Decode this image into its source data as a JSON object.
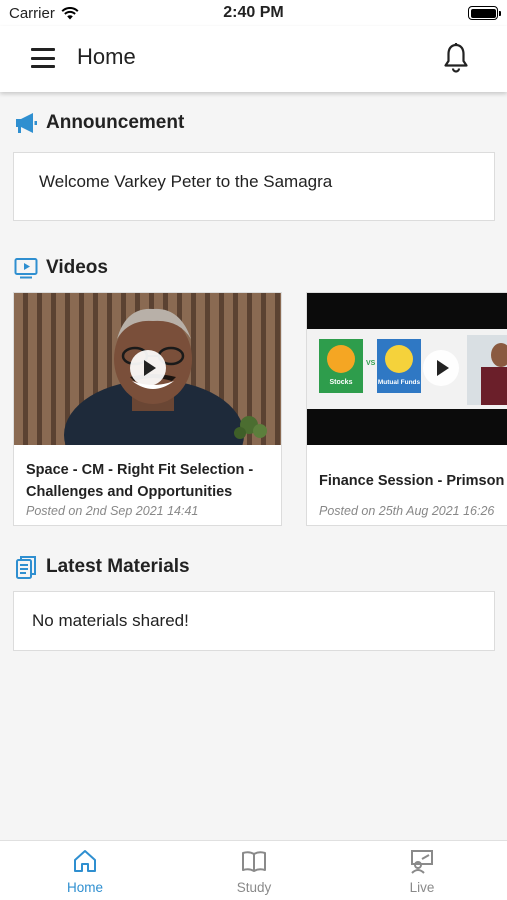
{
  "status_bar": {
    "carrier": "Carrier",
    "time": "2:40 PM"
  },
  "header": {
    "title": "Home"
  },
  "announcement": {
    "heading": "Announcement",
    "text": "Welcome Varkey Peter to the Samagra"
  },
  "videos": {
    "heading": "Videos",
    "items": [
      {
        "title": "Space - CM - Right Fit Selection - Challenges and Opportunities",
        "posted": "Posted on 2nd Sep 2021 14:41"
      },
      {
        "title": "Finance Session - Primson",
        "posted": "Posted on 25th Aug 2021 16:26",
        "thumb_left_label": "Stocks",
        "thumb_vs": "VS",
        "thumb_right_label": "Mutual Funds"
      }
    ]
  },
  "materials": {
    "heading": "Latest Materials",
    "empty_text": "No materials shared!"
  },
  "tabs": [
    {
      "label": "Home",
      "icon": "home-icon",
      "active": true
    },
    {
      "label": "Study",
      "icon": "book-icon",
      "active": false
    },
    {
      "label": "Live",
      "icon": "live-class-icon",
      "active": false
    }
  ],
  "colors": {
    "accent": "#2f8fd0",
    "inactive": "#8a8a8a"
  }
}
